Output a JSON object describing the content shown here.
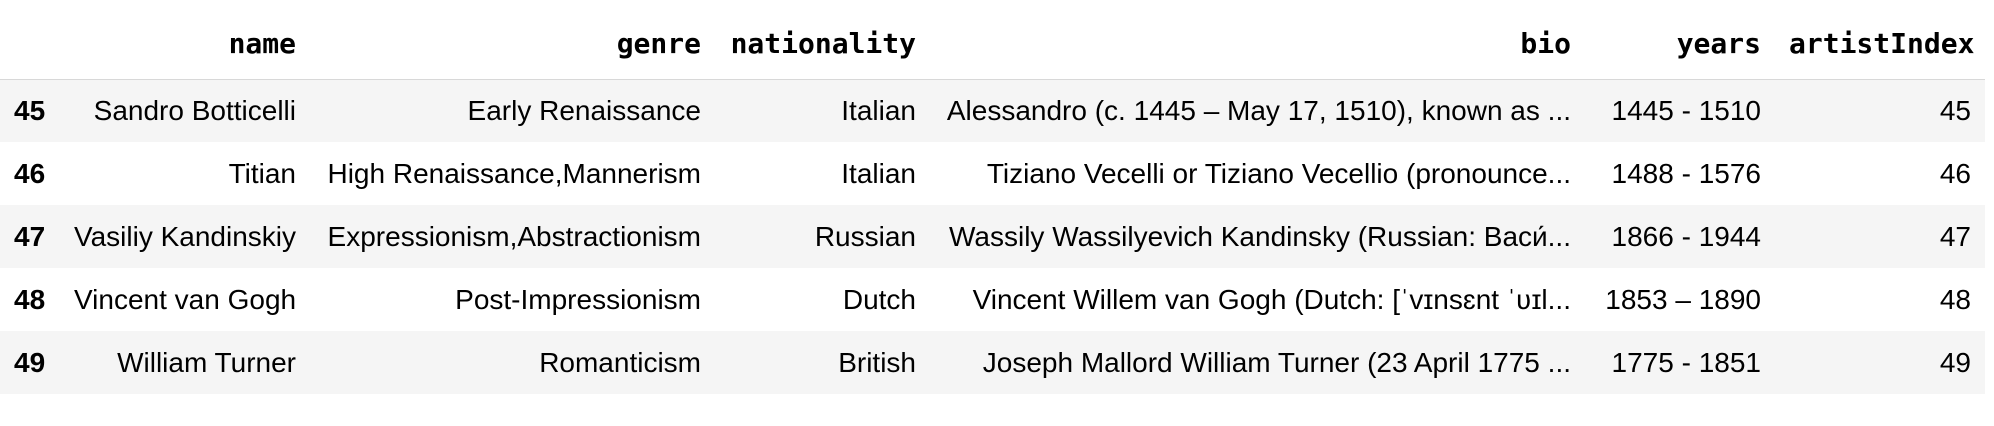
{
  "table": {
    "columns": [
      "name",
      "genre",
      "nationality",
      "bio",
      "years",
      "artistIndex"
    ],
    "rows": [
      {
        "index": "45",
        "name": "Sandro Botticelli",
        "genre": "Early Renaissance",
        "nationality": "Italian",
        "bio": "Alessandro (c. 1445 – May 17, 1510), known as ...",
        "years": "1445 - 1510",
        "artistIndex": "45"
      },
      {
        "index": "46",
        "name": "Titian",
        "genre": "High Renaissance,Mannerism",
        "nationality": "Italian",
        "bio": "Tiziano Vecelli or Tiziano Vecellio (pronounce...",
        "years": "1488 - 1576",
        "artistIndex": "46"
      },
      {
        "index": "47",
        "name": "Vasiliy Kandinskiy",
        "genre": "Expressionism,Abstractionism",
        "nationality": "Russian",
        "bio": "Wassily Wassilyevich Kandinsky (Russian: Васи́...",
        "years": "1866 - 1944",
        "artistIndex": "47"
      },
      {
        "index": "48",
        "name": "Vincent van Gogh",
        "genre": "Post-Impressionism",
        "nationality": "Dutch",
        "bio": "Vincent Willem van Gogh (Dutch: [ˈvɪnsɛnt ˈʋɪl...",
        "years": "1853 – 1890",
        "artistIndex": "48"
      },
      {
        "index": "49",
        "name": "William Turner",
        "genre": "Romanticism",
        "nationality": "British",
        "bio": "Joseph Mallord William Turner (23 April 1775 ...",
        "years": "1775 - 1851",
        "artistIndex": "49"
      }
    ]
  }
}
